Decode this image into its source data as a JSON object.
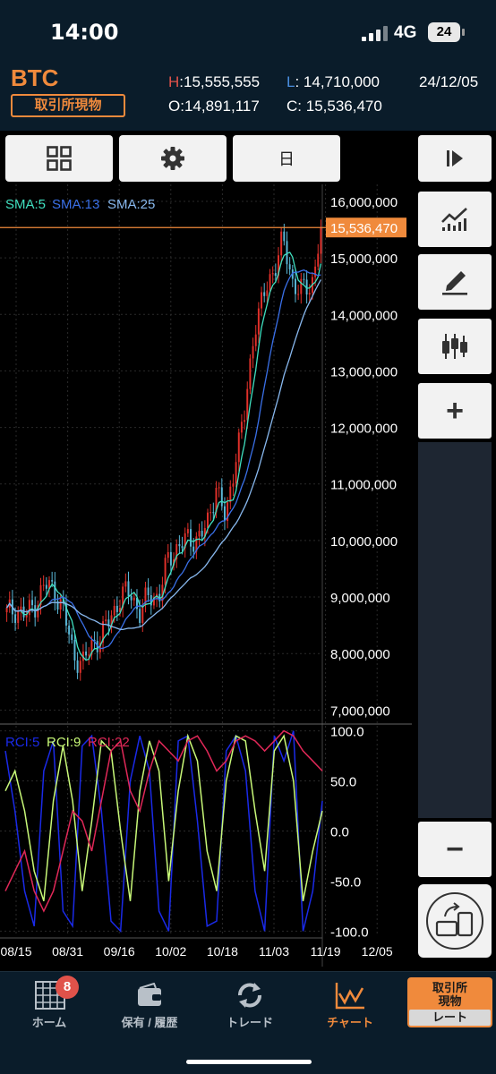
{
  "status_bar": {
    "time": "14:00",
    "network": "4G",
    "battery": "24"
  },
  "header": {
    "symbol": "BTC",
    "market_badge": "取引所現物",
    "high_key": "H",
    "high_value": "15,555,555",
    "low_key": "L",
    "low_value": "14,710,000",
    "open_key": "O",
    "open_value": "14,891,117",
    "close_key": "C",
    "close_value": "15,536,470",
    "date": "24/12/05"
  },
  "toolbar": {
    "grid_icon": "grid-icon",
    "settings_icon": "gear-icon",
    "period_label": "日",
    "play_icon": "skip-forward-icon"
  },
  "side_tools": {
    "indicator_icon": "line-chart-icon",
    "draw_icon": "pencil-icon",
    "candle_icon": "candlestick-icon",
    "zoom_in_label": "+",
    "zoom_out_label": "−",
    "rotate_icon": "rotate-device-icon"
  },
  "colors": {
    "accent": "#f08a3c",
    "candle_up": "#e0302a",
    "candle_down": "#5ab8d8",
    "sma5": "#40e0c0",
    "sma13": "#3a70e8",
    "sma25": "#88b8ee",
    "rci5": "#1a2ae8",
    "rci9": "#c8f878",
    "rci22": "#e02858"
  },
  "chart_data": [
    {
      "type": "candlestick",
      "title": "",
      "legend": [
        "SMA:5",
        "SMA:13",
        "SMA:25"
      ],
      "ylim": [
        6800000,
        16300000
      ],
      "y_ticks": [
        7000000,
        8000000,
        9000000,
        10000000,
        11000000,
        12000000,
        13000000,
        14000000,
        15000000,
        16000000
      ],
      "y_tick_labels": [
        "7,000,000",
        "8,000,000",
        "9,000,000",
        "10,000,000",
        "11,000,000",
        "12,000,000",
        "13,000,000",
        "14,000,000",
        "15,000,000",
        "16,000,000"
      ],
      "current_price": 15536470,
      "current_price_label": "15,536,470",
      "close_path": [
        [
          8700000,
          8.8
        ],
        [
          8800000,
          8.6
        ],
        [
          8650000,
          8.9
        ],
        [
          8900000,
          8.8
        ],
        [
          9200000,
          8.7
        ],
        [
          9150000,
          8.5
        ],
        [
          8700000,
          8.1
        ],
        [
          8000000,
          7.8
        ],
        [
          7800000,
          7.9
        ],
        [
          8200000,
          8.1
        ],
        [
          8300000,
          8.3
        ],
        [
          8700000,
          8.5
        ],
        [
          9000000,
          8.8
        ],
        [
          9100000,
          9.0
        ],
        [
          8700000,
          8.9
        ],
        [
          9050000,
          8.9
        ],
        [
          9000000,
          9.2
        ],
        [
          9700000,
          9.5
        ],
        [
          9900000,
          9.8
        ],
        [
          10000000,
          10.0
        ],
        [
          10050000,
          10.2
        ],
        [
          10200000,
          10.4
        ],
        [
          11000000,
          10.6
        ],
        [
          10300000,
          10.5
        ],
        [
          11500000,
          11.1
        ],
        [
          12200000,
          11.8
        ],
        [
          13800000,
          12.8
        ],
        [
          14300000,
          13.6
        ],
        [
          14800000,
          14.2
        ],
        [
          15300000,
          14.6
        ],
        [
          14600000,
          14.7
        ],
        [
          14400000,
          14.6
        ],
        [
          14500000,
          14.5
        ],
        [
          15536470,
          14.6
        ]
      ],
      "candle_count": 112
    },
    {
      "type": "line",
      "title": "",
      "legend": [
        "RCI:5",
        "RCI:9",
        "RCI:22"
      ],
      "ylim": [
        -105,
        105
      ],
      "y_ticks": [
        100,
        50,
        0,
        -50,
        -100
      ],
      "y_tick_labels": [
        "100.0",
        "50.0",
        "0.0",
        "-50.0",
        "-100.0"
      ],
      "x_tick_labels": [
        "08/15",
        "08/31",
        "09/16",
        "10/02",
        "10/18",
        "11/03",
        "11/19",
        "12/05"
      ],
      "series": [
        {
          "name": "RCI:5",
          "values": [
            80,
            20,
            -60,
            -95,
            60,
            90,
            -80,
            -95,
            85,
            95,
            20,
            -90,
            -100,
            50,
            95,
            60,
            -80,
            -100,
            90,
            95,
            10,
            -95,
            -90,
            80,
            95,
            60,
            -60,
            -100,
            95,
            70,
            100,
            -100,
            -60,
            30
          ]
        },
        {
          "name": "RCI:9",
          "values": [
            40,
            60,
            20,
            -40,
            -70,
            30,
            85,
            30,
            -60,
            10,
            90,
            80,
            0,
            -70,
            40,
            90,
            60,
            -50,
            40,
            95,
            70,
            -20,
            -60,
            50,
            95,
            90,
            20,
            -40,
            80,
            95,
            50,
            -70,
            -20,
            20
          ]
        },
        {
          "name": "RCI:22",
          "values": [
            -60,
            -40,
            -20,
            -60,
            -80,
            -60,
            -20,
            20,
            10,
            -20,
            30,
            80,
            90,
            40,
            20,
            60,
            90,
            80,
            70,
            90,
            95,
            80,
            60,
            70,
            90,
            95,
            90,
            80,
            90,
            100,
            95,
            80,
            70,
            60
          ]
        }
      ]
    }
  ],
  "tabs": [
    {
      "label": "ホーム",
      "badge": "8"
    },
    {
      "label": "保有 / 履歴"
    },
    {
      "label": "トレード"
    },
    {
      "label": "チャート"
    },
    {
      "label_line1": "取引所",
      "label_line2": "現物",
      "label_line3": "レート"
    }
  ]
}
